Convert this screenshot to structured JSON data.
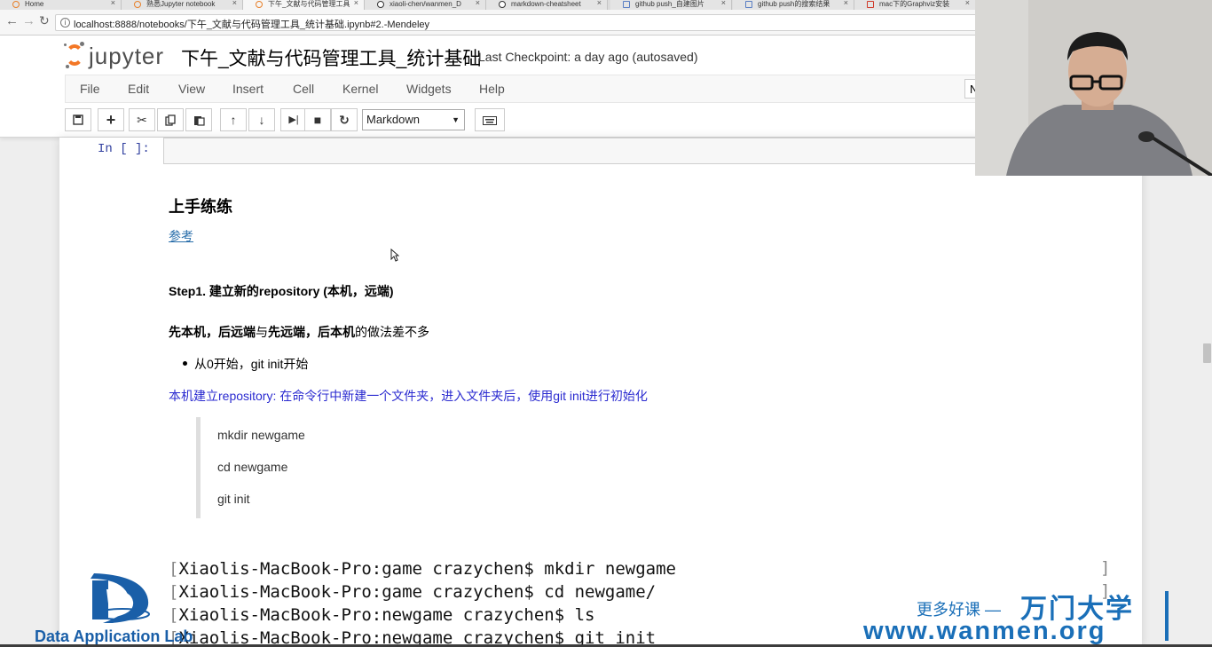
{
  "browser": {
    "tabs": [
      {
        "label": "Home",
        "icon": "jupyter-tab-icon"
      },
      {
        "label": "熟悉Jupyter notebook",
        "icon": "jupyter-tab-icon"
      },
      {
        "label": "下午_文献与代码管理工具",
        "icon": "jupyter-tab-icon",
        "active": true
      },
      {
        "label": "xiaoli-chen/wanmen_D",
        "icon": "github-tab-icon"
      },
      {
        "label": "markdown-cheatsheet",
        "icon": "github-tab-icon"
      },
      {
        "label": "github push_自建图片",
        "icon": "wordpress-tab-icon"
      },
      {
        "label": "github push的搜索结果",
        "icon": "wordpress-tab-icon"
      },
      {
        "label": "mac下的Graphviz安装",
        "icon": "csdn-tab-icon"
      }
    ],
    "tab_close": "×",
    "url": "localhost:8888/notebooks/下午_文献与代码管理工具_统计基础.ipynb#2.-Mendeley"
  },
  "jupyter": {
    "logo_text": "jupyter",
    "notebook_title": "下午_文献与代码管理工具_统计基础",
    "checkpoint": "Last Checkpoint: a day ago (autosaved)",
    "menu": [
      "File",
      "Edit",
      "View",
      "Insert",
      "Cell",
      "Kernel",
      "Widgets",
      "Help"
    ],
    "kernel_indicator": "N",
    "cell_type": "Markdown",
    "toolbar_icons": [
      "save-icon",
      "add-cell-icon",
      "cut-icon",
      "copy-icon",
      "paste-icon",
      "move-up-icon",
      "move-down-icon",
      "run-icon",
      "stop-icon",
      "restart-icon",
      "keyboard-icon"
    ]
  },
  "cell": {
    "prompt": "In [ ]:"
  },
  "content": {
    "heading": "上手练练",
    "ref_link": "参考",
    "step1": "Step1. 建立新的repository (本机，远端)",
    "compare_bold_1": "先本机，后远端",
    "compare_mid": "与",
    "compare_bold_2": "先远端，后本机",
    "compare_end": "的做法差不多",
    "bullet": "从0开始，git init开始",
    "blue_line": "本机建立repository: 在命令行中新建一个文件夹，进入文件夹后，使用git init进行初始化",
    "quote_lines": [
      "mkdir newgame",
      "cd newgame",
      "git init"
    ],
    "terminal_lines": [
      "Xiaolis-MacBook-Pro:game crazychen$ mkdir newgame",
      "Xiaolis-MacBook-Pro:game crazychen$ cd newgame/",
      "Xiaolis-MacBook-Pro:newgame crazychen$ ls",
      "Xiaolis-MacBook-Pro:newgame crazychen$ git init"
    ]
  },
  "watermark": {
    "left_text": "Data Application Lab",
    "slogan": "更多好课 —",
    "brand": "万门大学",
    "url": "www.wanmen.org"
  },
  "colors": {
    "jupyter_orange": "#f37726",
    "link_blue": "#296eaa",
    "text_blue": "#2b2bd0",
    "prompt_blue": "#303f9f",
    "watermark_blue": "#1a6fb8"
  }
}
